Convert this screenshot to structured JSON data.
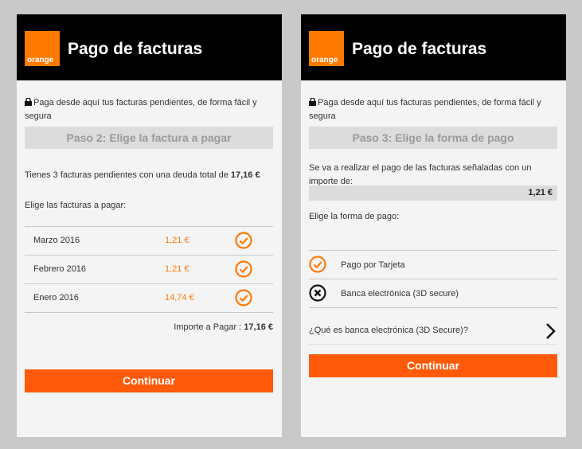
{
  "left": {
    "title": "Pago de facturas",
    "logo_text": "orange",
    "intro": "Paga desde aquí tus facturas pendientes, de forma fácil y segura",
    "step": "Paso 2: Elige la factura a pagar",
    "summary_text": "Tienes 3 facturas pendientes con una deuda total de ",
    "summary_amount": "17,16 €",
    "choose_label": "Elige las facturas a pagar:",
    "invoices": [
      {
        "month": "Marzo 2016",
        "amount": "1,21 €"
      },
      {
        "month": "Febrero 2016",
        "amount": "1,21 €"
      },
      {
        "month": "Enero 2016",
        "amount": "14,74 €"
      }
    ],
    "total_label": "Importe a Pagar : ",
    "total_amount": "17,16 €",
    "continue_label": "Continuar"
  },
  "right": {
    "title": "Pago de facturas",
    "logo_text": "orange",
    "intro": "Paga desde aquí tus facturas pendientes, de forma fácil y segura",
    "step": "Paso 3: Elige la forma de pago",
    "amount_text": "Se va a realizar el pago de las facturas señaladas con un importe de:",
    "amount": "1,21 €",
    "choose_label": "Elige la forma de pago:",
    "methods": [
      {
        "label": "Pago por Tarjeta",
        "icon": "check-icon"
      },
      {
        "label": "Banca electrónica (3D secure)",
        "icon": "close-circle-icon"
      }
    ],
    "faq_label": "¿Qué es banca electrónica (3D Secure)?",
    "continue_label": "Continuar"
  },
  "colors": {
    "accent": "#ff7900",
    "button": "#ff5a0a",
    "header": "#000000",
    "step_bg": "#dcdcdc"
  }
}
